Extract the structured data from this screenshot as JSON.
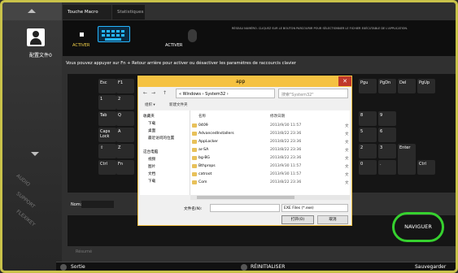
{
  "sidebar": {
    "profile_label": "配置文件0",
    "side_labels": [
      "AUDIO",
      "SUPPORT",
      "FLEXIKEY"
    ]
  },
  "tabs": {
    "macro": "Touche Macro",
    "stats": "Statistiques"
  },
  "panel": {
    "activer1": "ACTIVER",
    "activer2": "ACTIVER",
    "info": "Réseau numéro. Cliquez sur le bouton parcourir pour sélectionner le fichier exécutable de l'application.",
    "instruction": "Vous pouvez appuyer sur Fn + Retour arrière pour activer ou désactiver les paramètres de raccourcis clavier"
  },
  "keys": [
    "Esc",
    "F1",
    "1",
    "2",
    "Tab",
    "Q",
    "Caps Lock",
    "A",
    "⇧",
    "Z",
    "Ctrl",
    "Fn",
    "Pgu",
    "PgDn",
    "Del",
    "PgUp",
    "8",
    "9",
    "5",
    "6",
    "2",
    "3",
    "0",
    ".",
    "Enter",
    "Ctrl"
  ],
  "name_field": {
    "label": "Nom:"
  },
  "naviguer_button": "NAVIGUER",
  "resume": "Résumé",
  "footer": {
    "sortie": "Sortie",
    "reset": "RÉINITIALISER",
    "save": "Sauvegarder"
  },
  "dialog": {
    "title": "app",
    "close": "✕",
    "breadcrumb": "« Windows › System32 ›",
    "search_placeholder": "搜索\"System32\"",
    "toolbar": {
      "organize": "组织 ▾",
      "new_folder": "新建文件夹"
    },
    "tree": [
      "收藏夹",
      "下载",
      "桌面",
      "最近访问的位置",
      "这台电脑",
      "视频",
      "图片",
      "文档",
      "下载"
    ],
    "columns": {
      "name": "名称",
      "date": "修改日期"
    },
    "files": [
      {
        "name": "0409",
        "date": "2013/9/30 11:57",
        "type": "文"
      },
      {
        "name": "AdvancedInstallers",
        "date": "2013/8/22 23:36",
        "type": "文"
      },
      {
        "name": "AppLocker",
        "date": "2013/8/22 23:36",
        "type": "文"
      },
      {
        "name": "ar-SA",
        "date": "2013/8/22 23:36",
        "type": "文"
      },
      {
        "name": "bg-BG",
        "date": "2013/8/22 23:36",
        "type": "文"
      },
      {
        "name": "Bthprops",
        "date": "2013/9/30 11:57",
        "type": "文"
      },
      {
        "name": "catroot",
        "date": "2013/9/30 11:57",
        "type": "文"
      },
      {
        "name": "Com",
        "date": "2013/8/22 23:36",
        "type": "文"
      }
    ],
    "filename_label": "文件名(N):",
    "filter": "EXE Files (*.exe)",
    "open": "打开(O)",
    "cancel": "取消"
  }
}
